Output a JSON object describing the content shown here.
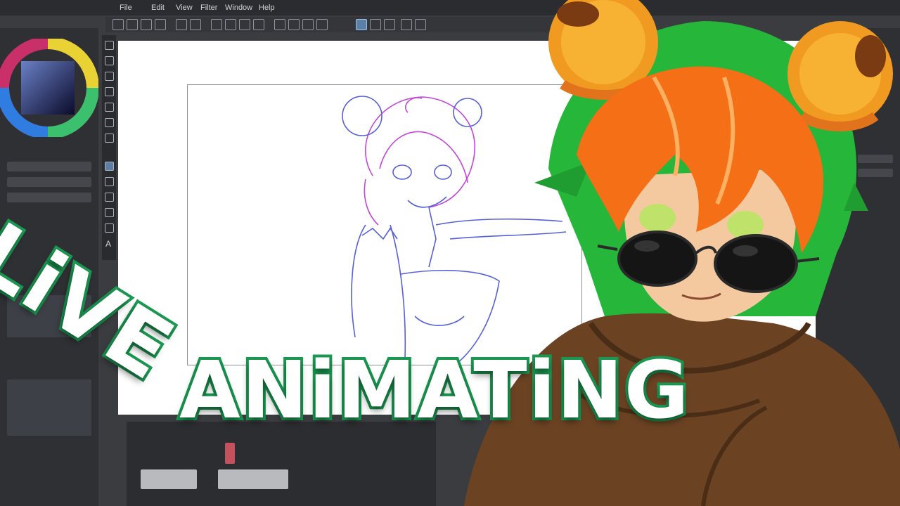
{
  "menu": {
    "items": [
      "File",
      "Edit",
      "View",
      "Filter",
      "Window",
      "Help"
    ]
  },
  "title_text": {
    "line1": "LiVE",
    "line2": "ANiMATiNG"
  },
  "colors": {
    "accent_green": "#1a9a52",
    "hair_orange": "#f46f15",
    "hair_green": "#25b63a",
    "scarf_brown": "#6b4323"
  },
  "icons": [
    "color-wheel-icon",
    "undo-icon",
    "redo-icon",
    "pen-tool-icon",
    "text-tool-icon",
    "move-tool-icon"
  ]
}
